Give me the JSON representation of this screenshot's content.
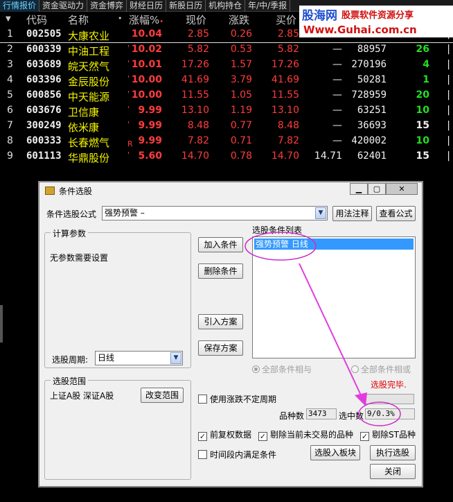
{
  "tabs": [
    "行情报价",
    "资金驱动力",
    "资金博弈",
    "财经日历",
    "新股日历",
    "机构持仓",
    "年/中/季报"
  ],
  "watermark": {
    "brand": "股海网",
    "slogan": "股票软件资源分享",
    "url": "Www.Guhai.com.cn"
  },
  "table": {
    "headers": {
      "code": "代码",
      "name": "名称",
      "flag": "•",
      "pct": "涨幅%",
      "price": "现价",
      "chg": "涨跌",
      "buy": "买价"
    },
    "rows": [
      {
        "n": "1",
        "code": "002505",
        "name": "大康农业",
        "mark": "",
        "pct": "10.04",
        "price": "2.85",
        "chg": "0.26",
        "buy": "2.85",
        "sell": "",
        "vol": "",
        "q": "",
        "qcolor": "white"
      },
      {
        "n": "2",
        "code": "600339",
        "name": "中油工程",
        "mark": "'",
        "pct": "10.02",
        "price": "5.82",
        "chg": "0.53",
        "buy": "5.82",
        "sell": "—",
        "vol": "88957",
        "q": "26",
        "qcolor": "green"
      },
      {
        "n": "3",
        "code": "603689",
        "name": "皖天然气",
        "mark": "'",
        "pct": "10.01",
        "price": "17.26",
        "chg": "1.57",
        "buy": "17.26",
        "sell": "—",
        "vol": "270196",
        "q": "4",
        "qcolor": "green"
      },
      {
        "n": "4",
        "code": "603396",
        "name": "金辰股份",
        "mark": "'",
        "pct": "10.00",
        "price": "41.69",
        "chg": "3.79",
        "buy": "41.69",
        "sell": "—",
        "vol": "50281",
        "q": "1",
        "qcolor": "green"
      },
      {
        "n": "5",
        "code": "600856",
        "name": "中天能源",
        "mark": "'",
        "pct": "10.00",
        "price": "11.55",
        "chg": "1.05",
        "buy": "11.55",
        "sell": "—",
        "vol": "728959",
        "q": "20",
        "qcolor": "green"
      },
      {
        "n": "6",
        "code": "603676",
        "name": "卫信康",
        "mark": "'",
        "pct": "9.99",
        "price": "13.10",
        "chg": "1.19",
        "buy": "13.10",
        "sell": "—",
        "vol": "63251",
        "q": "10",
        "qcolor": "green"
      },
      {
        "n": "7",
        "code": "300249",
        "name": "依米康",
        "mark": "'",
        "pct": "9.99",
        "price": "8.48",
        "chg": "0.77",
        "buy": "8.48",
        "sell": "—",
        "vol": "36693",
        "q": "15",
        "qcolor": "white"
      },
      {
        "n": "8",
        "code": "600333",
        "name": "长春燃气",
        "mark": "R",
        "pct": "9.99",
        "price": "7.82",
        "chg": "0.71",
        "buy": "7.82",
        "sell": "—",
        "vol": "420002",
        "q": "10",
        "qcolor": "green"
      },
      {
        "n": "9",
        "code": "601113",
        "name": "华鼎股份",
        "mark": "'",
        "pct": "5.60",
        "price": "14.70",
        "chg": "0.78",
        "buy": "14.70",
        "sell": "14.71",
        "vol": "62401",
        "q": "15",
        "qcolor": "white"
      }
    ]
  },
  "dialog": {
    "title": "条件选股",
    "formula_label": "条件选股公式",
    "formula_value": "强势预警        –",
    "usage_button": "用法注释",
    "view_formula_button": "查看公式",
    "params_group": "计算参数",
    "params_text": "无参数需要设置",
    "period_label": "选股周期:",
    "period_value": "日线",
    "scope_group": "选股范围",
    "scope_text": "上证A股  深证A股",
    "change_scope_button": "改变范围",
    "add_button": "加入条件",
    "delete_button": "删除条件",
    "import_button": "引入方案",
    "save_button": "保存方案",
    "list_label": "选股条件列表",
    "list_item": "强势预警    日线",
    "radio_and": "全部条件相与",
    "radio_or": "全部条件相或",
    "done_text": "选股完毕.",
    "variable_period_label": "使用涨跌不定周期",
    "count_label": "品种数",
    "count_value": "3473",
    "selected_label": "选中数",
    "selected_value": "9/0.3%",
    "adj_label": "前复权数据",
    "exclude_untraded_label": "剔除当前未交易的品种",
    "exclude_st_label": "剔除ST品种",
    "time_segment_label": "时间段内满足条件",
    "add_board_button": "选股入板块",
    "run_button": "执行选股",
    "close_button": "关闭"
  },
  "colors": {
    "annotation": "#cc2cc8",
    "selection": "#3399ff",
    "up": "#ff3c3c",
    "name": "#f4f400",
    "green": "#22e022"
  }
}
